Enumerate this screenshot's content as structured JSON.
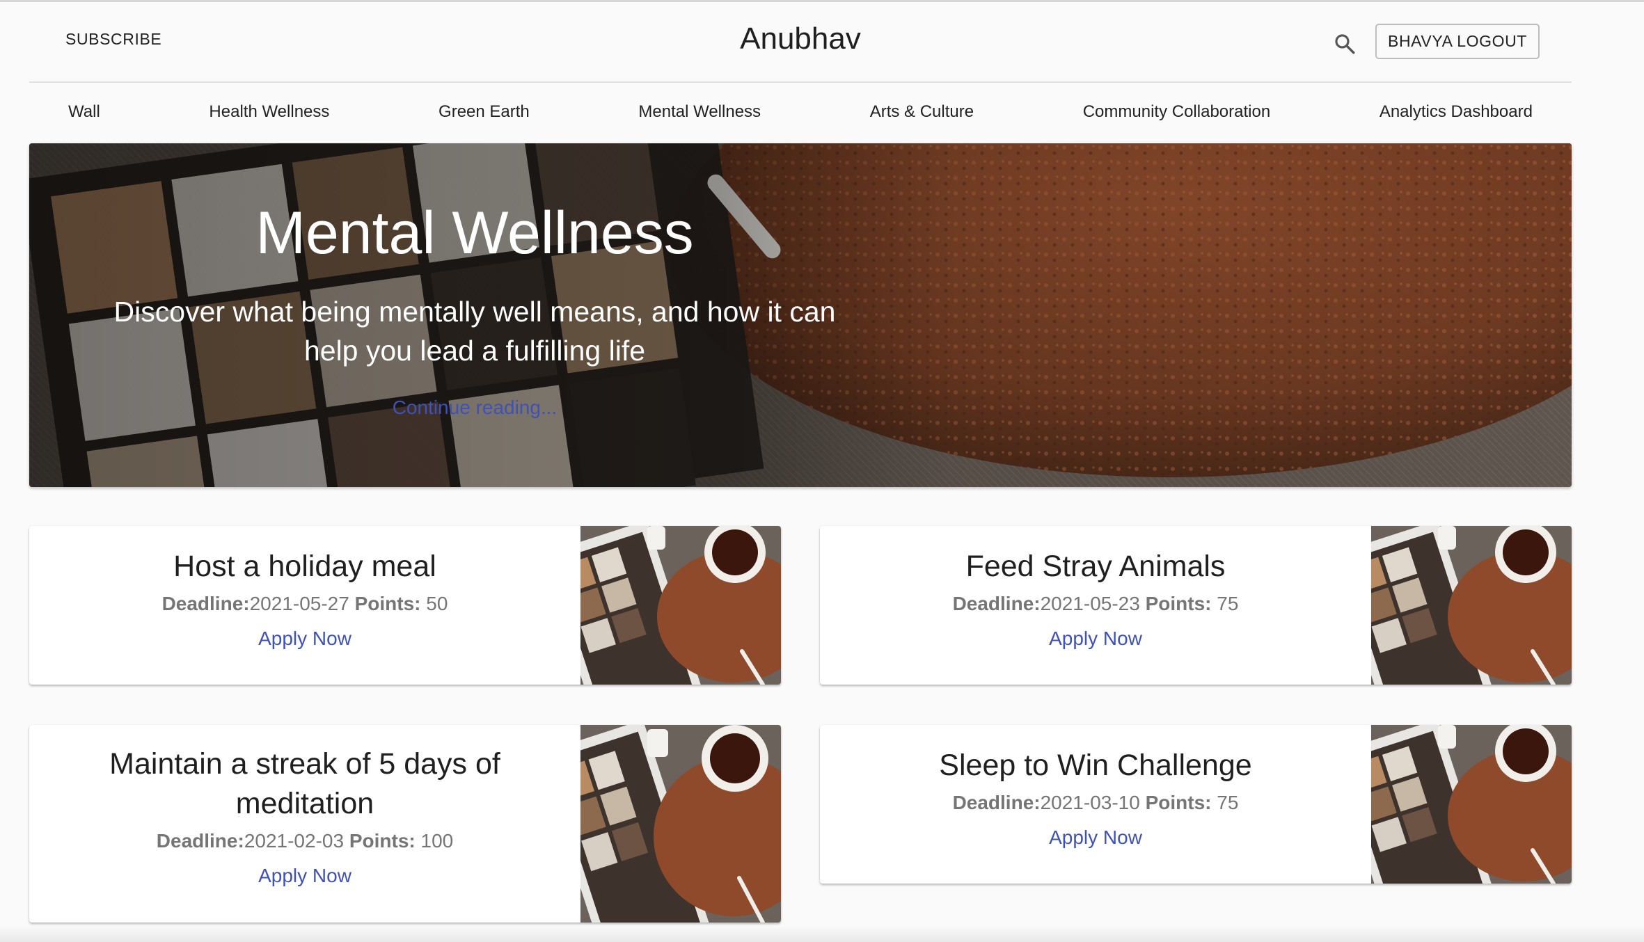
{
  "header": {
    "subscribe_label": "SUBSCRIBE",
    "brand": "Anubhav",
    "search_icon": "search-icon",
    "logout_label": "BHAVYA LOGOUT"
  },
  "nav": {
    "items": [
      {
        "label": "Wall"
      },
      {
        "label": "Health Wellness"
      },
      {
        "label": "Green Earth"
      },
      {
        "label": "Mental Wellness"
      },
      {
        "label": "Arts & Culture"
      },
      {
        "label": "Community Collaboration"
      },
      {
        "label": "Analytics Dashboard"
      }
    ]
  },
  "hero": {
    "title": "Mental Wellness",
    "text": "Discover what being mentally well means, and how it can help you lead a fulfilling life",
    "link": "Continue reading..."
  },
  "labels": {
    "deadline": "Deadline:",
    "points": "Points:"
  },
  "cards": [
    {
      "title": "Host a holiday meal",
      "deadline": "2021-05-27",
      "points": "50",
      "cta": "Apply Now"
    },
    {
      "title": "Feed Stray Animals",
      "deadline": "2021-05-23",
      "points": "75",
      "cta": "Apply Now"
    },
    {
      "title": "Maintain a streak of 5 days of meditation",
      "deadline": "2021-02-03",
      "points": "100",
      "cta": "Apply Now"
    },
    {
      "title": "Sleep to Win Challenge",
      "deadline": "2021-03-10",
      "points": "75",
      "cta": "Apply Now"
    }
  ],
  "colors": {
    "background": "#fafafa",
    "link": "#3f51b5",
    "meta_text": "#757575"
  }
}
